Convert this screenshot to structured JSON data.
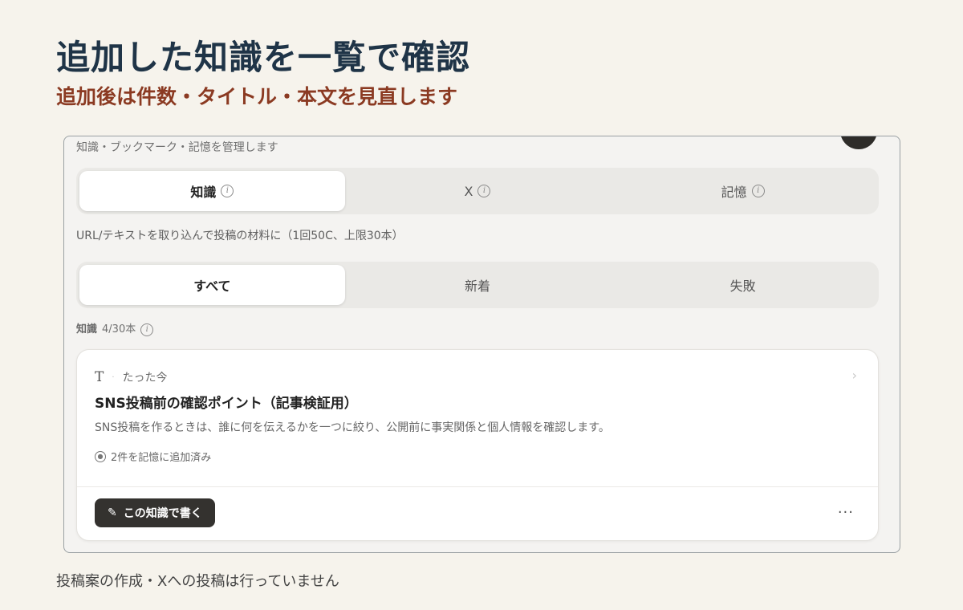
{
  "slide": {
    "title": "追加した知識を一覧で確認",
    "subtitle": "追加後は件数・タイトル・本文を見直します",
    "footer": "投稿案の作成・Xへの投稿は行っていません"
  },
  "app": {
    "description": "知識・ブックマーク・記憶を管理します",
    "tabs": [
      {
        "label": "知識",
        "active": true
      },
      {
        "label": "X",
        "active": false
      },
      {
        "label": "記憶",
        "active": false
      }
    ],
    "import_description": "URL/テキストを取り込んで投稿の材料に（1回50C、上限30本）",
    "filters": [
      {
        "label": "すべて",
        "active": true
      },
      {
        "label": "新着",
        "active": false
      },
      {
        "label": "失敗",
        "active": false
      }
    ],
    "count": {
      "label": "知識",
      "value": "4/30本"
    },
    "card": {
      "type_icon": "T",
      "time": "たった今",
      "title": "SNS投稿前の確認ポイント（記事検証用）",
      "body": "SNS投稿を作るときは、誰に何を伝えるかを一つに絞り、公開前に事実関係と個人情報を確認します。",
      "memory_status": "2件を記憶に追加済み",
      "write_button": "この知識で書く",
      "more": "···"
    }
  },
  "colors": {
    "title": "#1f3447",
    "subtitle": "#8b3a22",
    "background": "#f6f3ec",
    "button_dark": "#34322f"
  }
}
